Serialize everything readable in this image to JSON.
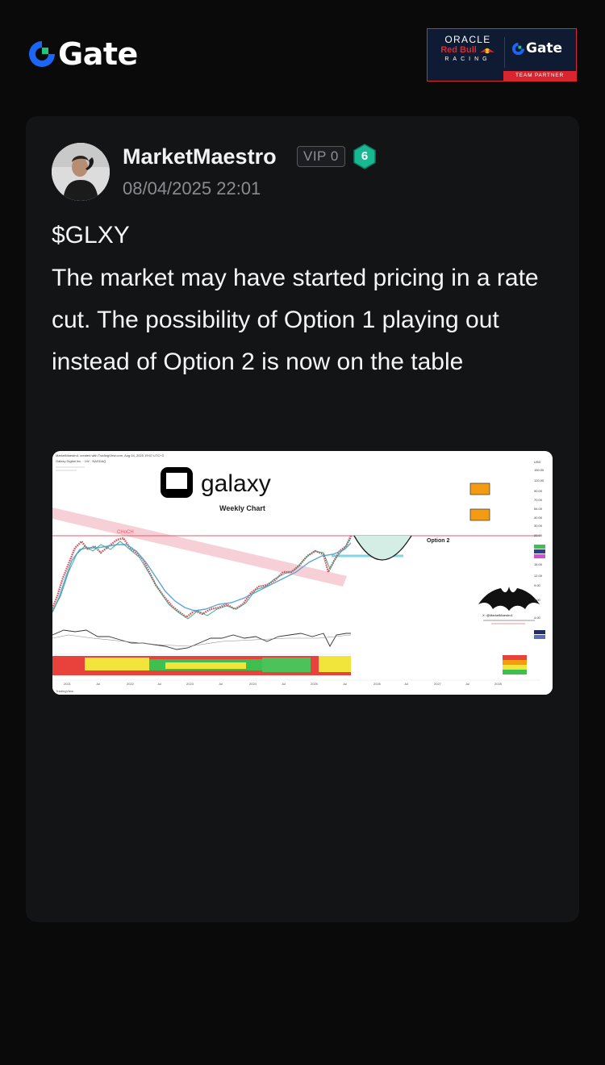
{
  "brand": {
    "name": "Gate",
    "logo_icon": "gate-logo-icon",
    "accent": "#1b66f5",
    "accent2": "#21c47d"
  },
  "partner_badge": {
    "oracle": "ORACLE",
    "red_bull": "Red Bull",
    "racing": "RACING",
    "partner_brand": "Gate",
    "label": "TEAM PARTNER"
  },
  "post": {
    "author": "MarketMaestro",
    "vip_label": "VIP 0",
    "level": "6",
    "timestamp": "08/04/2025 22:01",
    "ticker": "$GLXY",
    "text": "The market may have started pricing in a rate cut. The possibility of Option 1 playing out instead of Option 2 is now on the table"
  },
  "chart_image": {
    "header_line": "MarketMaestro1 created with TradingView.com, Aug 04, 2025 19:57 UTC+3",
    "symbol_line": "Galaxy Digital Inc. · 1W · NASDAQ",
    "brand": "galaxy",
    "subtitle": "Weekly Chart",
    "choch_label": "CHoCH",
    "option_label": "Option 2",
    "watermark_label": "X: @MarketMaestro1",
    "footer": "TradingView",
    "x_ticks": [
      "2021",
      "Jul",
      "2022",
      "Jul",
      "2023",
      "Jul",
      "2024",
      "Jul",
      "2025",
      "Jul",
      "2026",
      "Jul",
      "2027",
      "Jul",
      "2028"
    ],
    "y_ticks": [
      "USD",
      "150.00",
      "120.00",
      "90.00",
      "70.00",
      "54.00",
      "40.00",
      "30.00",
      "22.00",
      "16.00",
      "12.00",
      "9.00",
      "6.00",
      "4.00"
    ]
  }
}
